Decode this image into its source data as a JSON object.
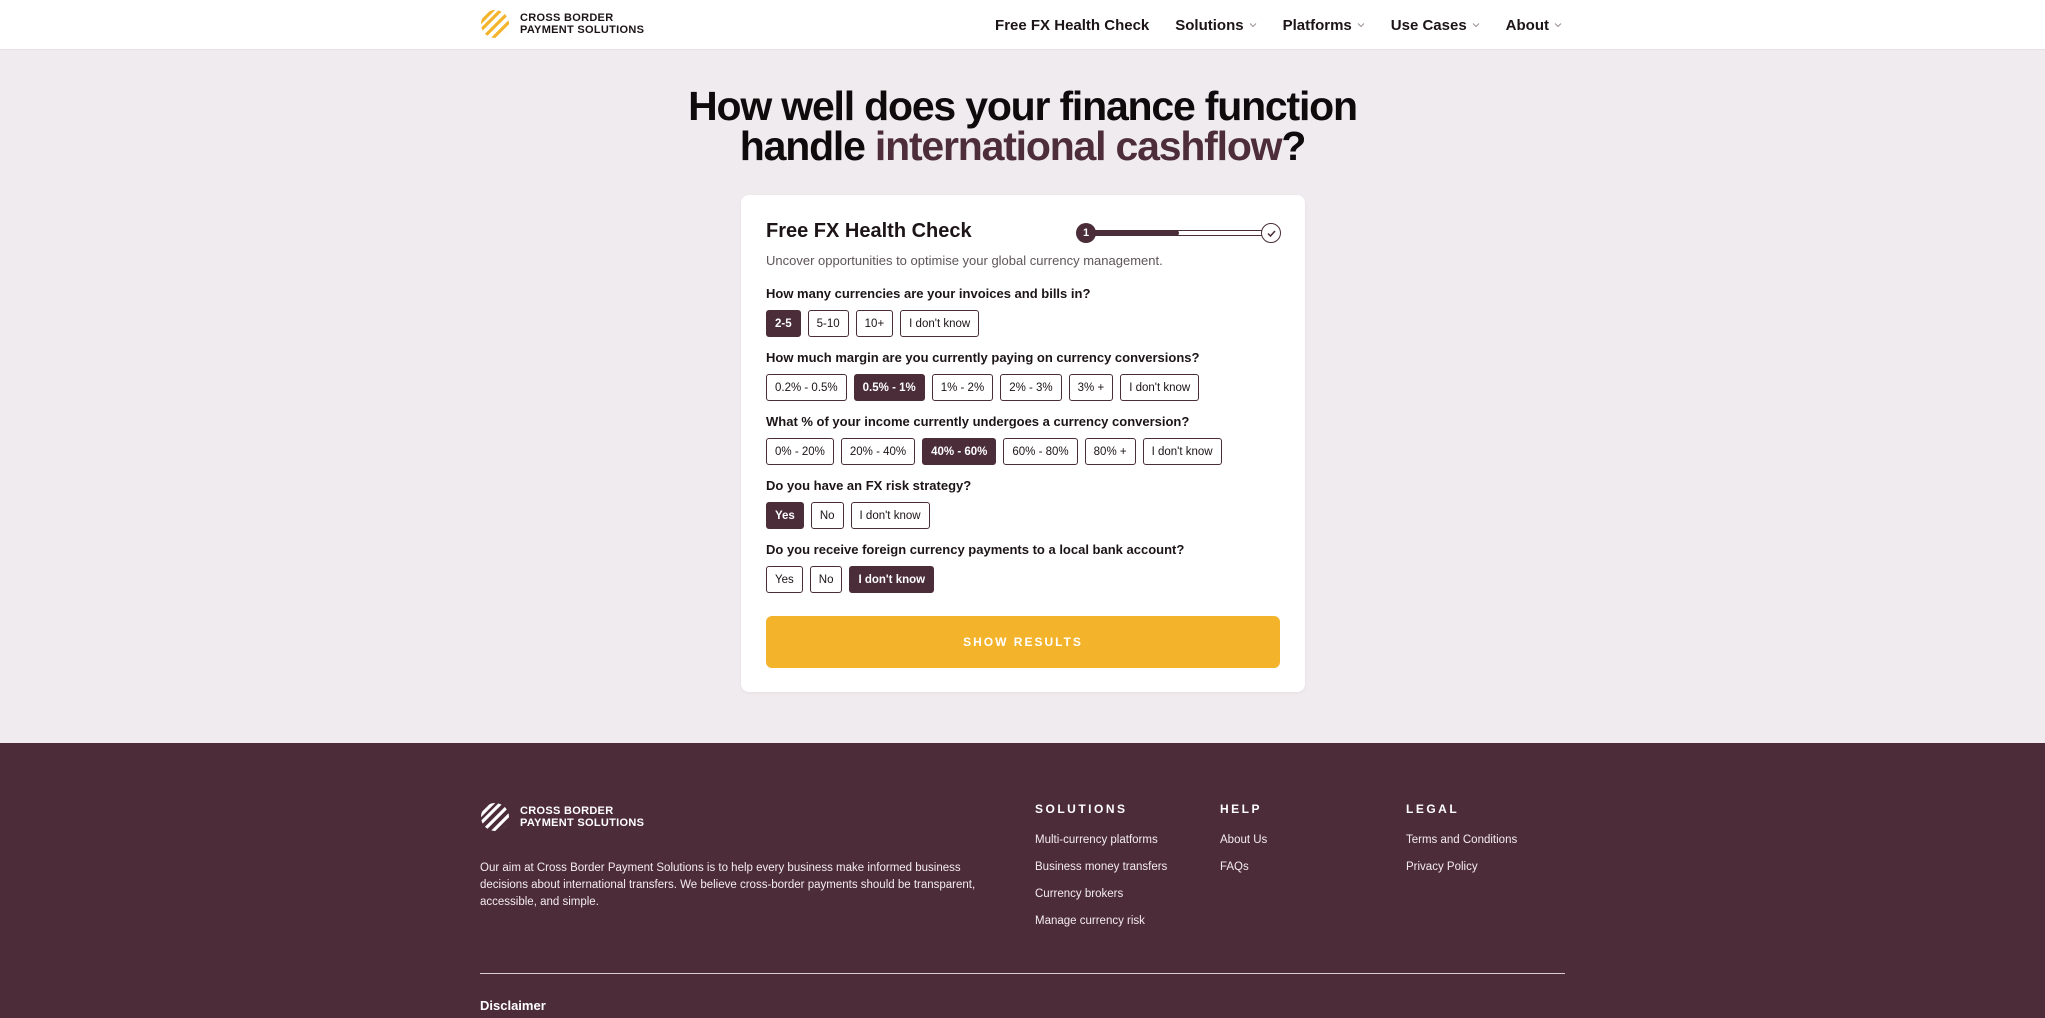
{
  "brand": {
    "line1": "CROSS BORDER",
    "line2": "PAYMENT SOLUTIONS"
  },
  "nav": [
    {
      "label": "Free FX Health Check",
      "dropdown": false
    },
    {
      "label": "Solutions",
      "dropdown": true
    },
    {
      "label": "Platforms",
      "dropdown": true
    },
    {
      "label": "Use Cases",
      "dropdown": true
    },
    {
      "label": "About",
      "dropdown": true
    }
  ],
  "hero": {
    "line1": "How well does your finance function",
    "line2_pre": "handle ",
    "line2_accent": "international cashflow",
    "line2_post": "?"
  },
  "card": {
    "title": "Free FX Health Check",
    "subtitle": "Uncover opportunities to optimise your global currency management.",
    "progress": {
      "step": "1",
      "fraction": 0.5
    },
    "questions": [
      {
        "label": "How many currencies are your invoices and bills in?",
        "options": [
          "2-5",
          "5-10",
          "10+",
          "I don't know"
        ],
        "selected": 0
      },
      {
        "label": "How much margin are you currently paying on currency conversions?",
        "options": [
          "0.2% - 0.5%",
          "0.5% - 1%",
          "1% - 2%",
          "2% - 3%",
          "3% +",
          "I don't know"
        ],
        "selected": 1
      },
      {
        "label": "What % of your income currently undergoes a currency conversion?",
        "options": [
          "0% - 20%",
          "20% - 40%",
          "40% - 60%",
          "60% - 80%",
          "80% +",
          "I don't know"
        ],
        "selected": 2
      },
      {
        "label": "Do you have an FX risk strategy?",
        "options": [
          "Yes",
          "No",
          "I don't know"
        ],
        "selected": 0
      },
      {
        "label": "Do you receive foreign currency payments to a local bank account?",
        "options": [
          "Yes",
          "No",
          "I don't know"
        ],
        "selected": 2
      }
    ],
    "cta": "SHOW RESULTS"
  },
  "footer": {
    "about": "Our aim at Cross Border Payment Solutions is to help every business make informed business decisions about international transfers. We believe cross-border payments should be transparent, accessible, and simple.",
    "columns": [
      {
        "heading": "SOLUTIONS",
        "links": [
          "Multi-currency platforms",
          "Business money transfers",
          "Currency brokers",
          "Manage currency risk"
        ]
      },
      {
        "heading": "HELP",
        "links": [
          "About Us",
          "FAQs"
        ]
      },
      {
        "heading": "LEGAL",
        "links": [
          "Terms and Conditions",
          "Privacy Policy"
        ]
      }
    ],
    "disclaimer": "Disclaimer"
  },
  "colors": {
    "primary": "#4a2d39",
    "accent": "#f3b32a",
    "footer_bg": "#4d2c39",
    "page_bg": "#f0ebee"
  },
  "icons": {
    "logo": "striped-sphere-logo",
    "dropdown": "chevron-down-icon",
    "complete": "check-icon"
  }
}
